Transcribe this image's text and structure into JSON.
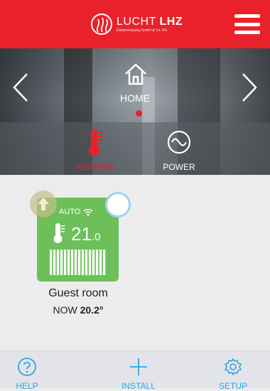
{
  "header": {
    "logo_name_light": "LUCHT",
    "logo_name_bold": "LHZ",
    "logo_sub": "Elektroheizung GmbH & Co. KG",
    "menu_icon": "hamburger-icon"
  },
  "hero": {
    "current_mode": "HOME",
    "tabs": [
      {
        "label": "HEATING",
        "active": true
      },
      {
        "label": "POWER",
        "active": false
      }
    ]
  },
  "room": {
    "mode": "AUTO",
    "setpoint_whole": "21",
    "setpoint_decimal": ".0",
    "name": "Guest room",
    "now_label": "NOW",
    "now_value": "20.2°",
    "card_color": "#6dbf5a"
  },
  "bottom_nav": {
    "help": "HELP",
    "install": "INSTALL",
    "setup": "SETUP"
  },
  "colors": {
    "brand_red": "#e8212b",
    "accent_blue": "#2aa7dd"
  }
}
